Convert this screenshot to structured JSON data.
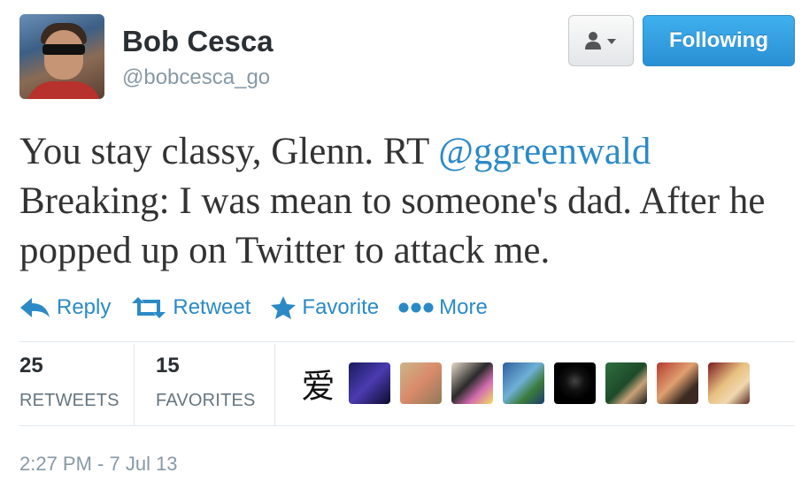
{
  "profile": {
    "name": "Bob Cesca",
    "handle": "@bobcesca_go",
    "follow_label": "Following"
  },
  "tweet": {
    "text_before": "You stay classy, Glenn. RT ",
    "mention": "@ggreenwald",
    "text_after": " Breaking: I was mean to someone's dad. After he popped up on Twitter to attack me."
  },
  "actions": {
    "reply": "Reply",
    "retweet": "Retweet",
    "favorite": "Favorite",
    "more": "More"
  },
  "stats": {
    "retweets_count": "25",
    "retweets_label": "RETWEETS",
    "favorites_count": "15",
    "favorites_label": "FAVORITES"
  },
  "favoriters": {
    "kanji": "爱",
    "thumbs": [
      {
        "bg": "linear-gradient(135deg,#1a1a5e,#4b3bb0 50%,#0c0c30)"
      },
      {
        "bg": "linear-gradient(135deg,#c9b68a,#d98a6a 50%,#8f7a5a)"
      },
      {
        "bg": "linear-gradient(135deg,#e8dccb,#2a2a2a 45%,#d46cb0 70%,#f0e060)"
      },
      {
        "bg": "linear-gradient(135deg,#2f5f9e,#6fb0d6 45%,#3a7a3a 70%,#1c3d6e)"
      },
      {
        "bg": "radial-gradient(circle at 50% 45%,#444 0,#111 30%,#000 60%)"
      },
      {
        "bg": "linear-gradient(135deg,#2f6f3f,#1d4a2a 50%,#c9a27a 70%,#1a1a1a)"
      },
      {
        "bg": "linear-gradient(135deg,#b43b2e,#e0a070 45%,#3a2a22 75%)"
      },
      {
        "bg": "linear-gradient(135deg,#7a1a20,#e8c080 45%,#f0d8b0 70%,#5a2a20)"
      }
    ]
  },
  "timestamp": "2:27 PM - 7 Jul 13"
}
